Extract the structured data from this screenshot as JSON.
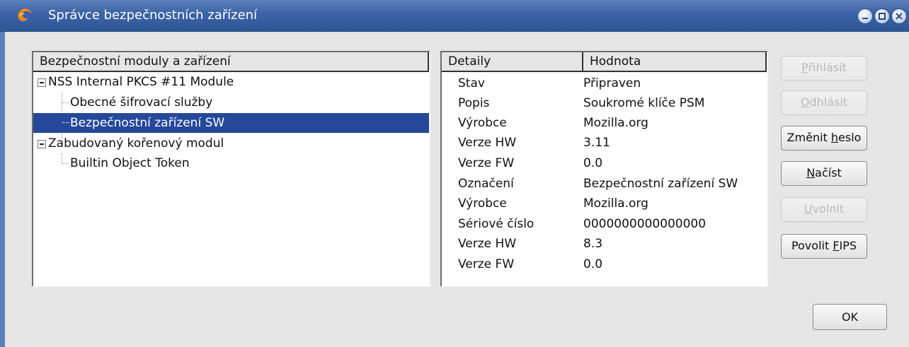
{
  "window": {
    "title": "Správce bezpečnostních zařízení"
  },
  "modules": {
    "header": "Bezpečnostní moduly a zařízení",
    "items": [
      {
        "label": "NSS Internal PKCS #11 Module"
      },
      {
        "label": "Obecné šifrovací služby"
      },
      {
        "label": "Bezpečnostní zařízení SW"
      },
      {
        "label": "Zabudovaný kořenový modul"
      },
      {
        "label": "Builtin Object Token"
      }
    ]
  },
  "details": {
    "header_key": "Detaily",
    "header_value": "Hodnota",
    "rows": [
      {
        "key": "Stav",
        "value": "Připraven"
      },
      {
        "key": "Popis",
        "value": "Soukromé klíče PSM"
      },
      {
        "key": "Výrobce",
        "value": "Mozilla.org"
      },
      {
        "key": "Verze HW",
        "value": "3.11"
      },
      {
        "key": "Verze FW",
        "value": "0.0"
      },
      {
        "key": "Označení",
        "value": "Bezpečnostní zařízení SW"
      },
      {
        "key": "Výrobce",
        "value": "Mozilla.org"
      },
      {
        "key": "Sériové číslo",
        "value": "0000000000000000"
      },
      {
        "key": "Verze HW",
        "value": "8.3"
      },
      {
        "key": "Verze FW",
        "value": "0.0"
      }
    ]
  },
  "buttons": {
    "login": {
      "pre": "",
      "key": "P",
      "post": "řihlásit"
    },
    "logout": {
      "pre": "",
      "key": "O",
      "post": "dhlásit"
    },
    "change_password": {
      "pre": "Změnit ",
      "key": "h",
      "post": "eslo"
    },
    "load": {
      "pre": "",
      "key": "N",
      "post": "ačíst"
    },
    "unload": {
      "pre": "",
      "key": "U",
      "post": "volnit"
    },
    "fips": {
      "pre": "Povolit ",
      "key": "F",
      "post": "IPS"
    },
    "ok": "OK"
  },
  "icons": {
    "app": "firefox-icon",
    "minimize": "minimize-icon",
    "maximize": "maximize-icon",
    "close": "close-icon"
  }
}
